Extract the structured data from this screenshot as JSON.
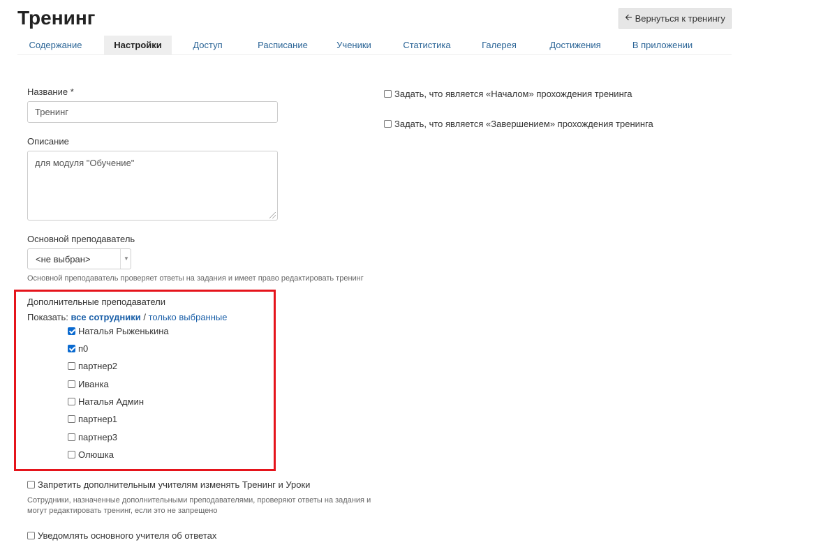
{
  "header": {
    "title": "Тренинг",
    "back_button_label": "Вернуться к тренингу",
    "back_icon": "arrow-left-icon"
  },
  "tabs": [
    {
      "label": "Содержание",
      "active": false
    },
    {
      "label": "Настройки",
      "active": true
    },
    {
      "label": "Доступ",
      "active": false
    },
    {
      "label": "Расписание",
      "active": false
    },
    {
      "label": "Ученики",
      "active": false
    },
    {
      "label": "Статистика",
      "active": false
    },
    {
      "label": "Галерея",
      "active": false
    },
    {
      "label": "Достижения",
      "active": false
    },
    {
      "label": "В приложении",
      "active": false
    }
  ],
  "form": {
    "name_label": "Название *",
    "name_value": "Тренинг",
    "description_label": "Описание",
    "description_value": "для модуля \"Обучение\"",
    "main_teacher_label": "Основной преподаватель",
    "main_teacher_value": "<не выбран>",
    "main_teacher_hint": "Основной преподаватель проверяет ответы на задания и имеет право редактировать тренинг",
    "extra_teachers_label": "Дополнительные преподаватели",
    "show_label": "Показать:",
    "show_all": "все сотрудники",
    "show_separator": "/",
    "show_selected": "только выбранные",
    "teachers": [
      {
        "name": "Наталья Рыженькина",
        "checked": true
      },
      {
        "name": "п0",
        "checked": true
      },
      {
        "name": "партнер2",
        "checked": false
      },
      {
        "name": "Иванка",
        "checked": false
      },
      {
        "name": "Наталья Админ",
        "checked": false
      },
      {
        "name": "партнер1",
        "checked": false
      },
      {
        "name": "партнер3",
        "checked": false
      },
      {
        "name": "Олюшка",
        "checked": false
      }
    ],
    "forbid_label": "Запретить дополнительным учителям изменять Тренинг и Уроки",
    "forbid_checked": false,
    "forbid_hint_line1": "Сотрудники, назначенные дополнительными преподавателями, проверяют ответы на задания и",
    "forbid_hint_line2": "могут редактировать тренинг, если это не запрещено",
    "notify_label": "Уведомлять основного учителя об ответах",
    "notify_checked": false,
    "start_label": "Задать, что является «Началом» прохождения тренинга",
    "start_checked": false,
    "finish_label": "Задать, что является «Завершением» прохождения тренинга",
    "finish_checked": false
  },
  "colors": {
    "link": "#1a5fa8",
    "highlight": "#e5141b",
    "checkbox": "#0a6ad0"
  }
}
